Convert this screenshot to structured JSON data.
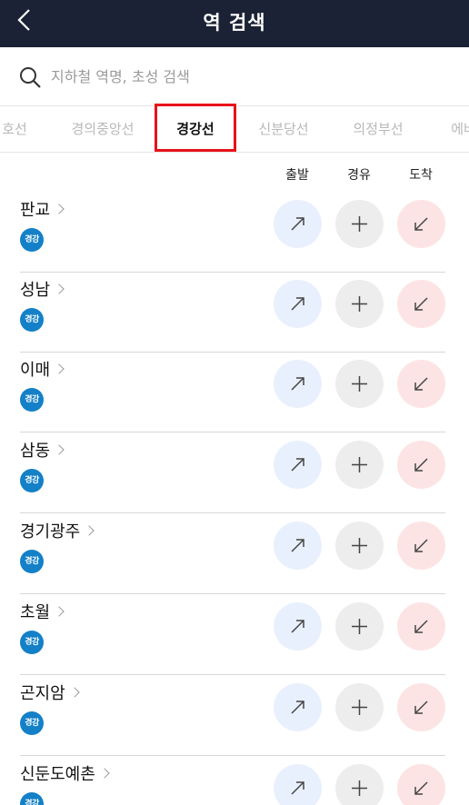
{
  "header": {
    "title": "역 검색"
  },
  "search": {
    "placeholder": "지하철 역명, 초성 검색"
  },
  "tabs": [
    {
      "label": "호선"
    },
    {
      "label": "경의중앙선"
    },
    {
      "label": "경강선"
    },
    {
      "label": "신분당선"
    },
    {
      "label": "의정부선"
    },
    {
      "label": "에버"
    }
  ],
  "active_tab": "경강선",
  "columns": {
    "departure": "출발",
    "via": "경유",
    "arrival": "도착"
  },
  "stations": [
    {
      "name": "판교",
      "line_badge": "경강"
    },
    {
      "name": "성남",
      "line_badge": "경강"
    },
    {
      "name": "이매",
      "line_badge": "경강"
    },
    {
      "name": "삼동",
      "line_badge": "경강"
    },
    {
      "name": "경기광주",
      "line_badge": "경강"
    },
    {
      "name": "초월",
      "line_badge": "경강"
    },
    {
      "name": "곤지암",
      "line_badge": "경강"
    },
    {
      "name": "신둔도예촌",
      "line_badge": "경강"
    }
  ],
  "colors": {
    "header_bg": "#1b2235",
    "line_badge": "#1380c7",
    "highlight_box": "#e8121a",
    "departure_btn": "#e9f0fd",
    "via_btn": "#ededed",
    "arrival_btn": "#fde4e4"
  },
  "icons": {
    "back": "chevron-left-icon",
    "search": "magnifier-icon",
    "departure": "arrow-up-right-icon",
    "via": "plus-icon",
    "arrival": "arrow-down-left-icon"
  }
}
